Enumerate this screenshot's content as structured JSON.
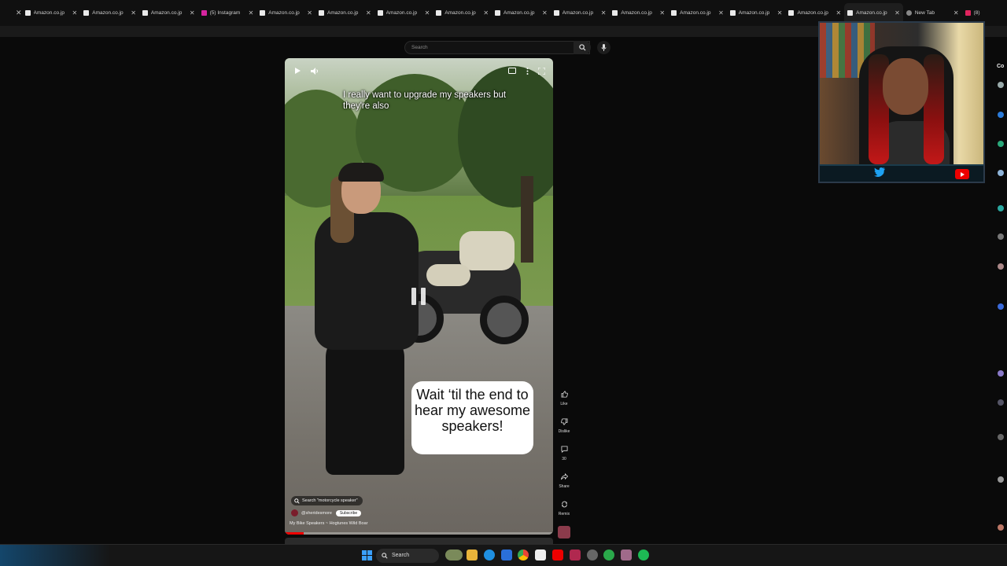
{
  "browser": {
    "tabs": [
      {
        "label": "Amazon.co.jp",
        "favicon": "amazon-icon"
      },
      {
        "label": "Amazon.co.jp",
        "favicon": "amazon-icon"
      },
      {
        "label": "Amazon.co.jp",
        "favicon": "amazon-icon"
      },
      {
        "label": "(5) Instagram",
        "favicon": "instagram-icon"
      },
      {
        "label": "Amazon.co.jp",
        "favicon": "amazon-icon"
      },
      {
        "label": "Amazon.co.jp",
        "favicon": "amazon-icon"
      },
      {
        "label": "Amazon.co.jp",
        "favicon": "amazon-icon"
      },
      {
        "label": "Amazon.co.jp",
        "favicon": "amazon-icon"
      },
      {
        "label": "Amazon.co.jp",
        "favicon": "amazon-icon"
      },
      {
        "label": "Amazon.co.jp",
        "favicon": "amazon-icon"
      },
      {
        "label": "Amazon.co.jp",
        "favicon": "amazon-icon"
      },
      {
        "label": "Amazon.co.jp",
        "favicon": "amazon-icon"
      },
      {
        "label": "Amazon.co.jp",
        "favicon": "amazon-icon"
      },
      {
        "label": "Amazon.co.jp",
        "favicon": "amazon-icon"
      },
      {
        "label": "Amazon.co.jp",
        "favicon": "amazon-icon"
      },
      {
        "label": "New Tab",
        "favicon": "chrome-icon"
      },
      {
        "label": "(8)",
        "favicon": "youtube-icon"
      }
    ],
    "active_tab_index": 14
  },
  "youtube": {
    "search_placeholder": "Search"
  },
  "short": {
    "caption": "I really want to upgrade my speakers but they're also",
    "overlay_text": "Wait ‘til the end to hear my awesome speakers!",
    "search_chip": "Search \"motorcycle speaker\"",
    "channel_handle": "@sheridesmore",
    "subscribe_label": "Subscribe",
    "song": "My Bike Speakers ~ Hogtunes Wild Boar",
    "progress_fraction": 0.07,
    "actions": {
      "like_label": "Like",
      "dislike_label": "Dislike",
      "comments_count": "30",
      "share_label": "Share",
      "remix_label": "Remix"
    }
  },
  "chat": {
    "title_fragment": "Co"
  },
  "taskbar": {
    "search_label": "Search"
  },
  "colors": {
    "accent_red": "#e00000",
    "twitter_blue": "#1da1f2",
    "windows_blue": "#3aa0ff"
  }
}
